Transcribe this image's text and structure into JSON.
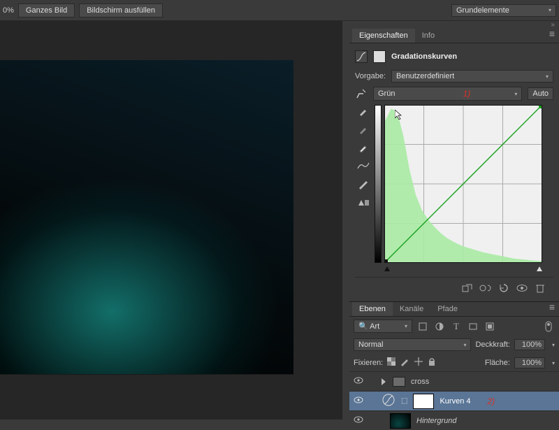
{
  "topbar": {
    "zoom": "0%",
    "fit_image": "Ganzes Bild",
    "fill_screen": "Bildschirm ausfüllen",
    "workspace": "Grundelemente"
  },
  "properties": {
    "tab_properties": "Eigenschaften",
    "tab_info": "Info",
    "title": "Gradationskurven",
    "preset_label": "Vorgabe:",
    "preset_value": "Benutzerdefiniert",
    "channel_value": "Grün",
    "auto_btn": "Auto",
    "annotation1": "1)"
  },
  "chart_data": {
    "type": "area",
    "title": "Grün channel histogram with curve",
    "xlabel": "",
    "ylabel": "",
    "xlim": [
      0,
      255
    ],
    "ylim": [
      0,
      255
    ],
    "series": [
      {
        "name": "curve",
        "type": "line",
        "x": [
          0,
          255
        ],
        "values": [
          0,
          255
        ]
      },
      {
        "name": "histogram",
        "type": "area",
        "x": [
          0,
          10,
          20,
          30,
          40,
          50,
          60,
          70,
          80,
          90,
          100,
          110,
          120,
          130,
          140,
          150,
          160,
          170,
          180,
          190,
          200,
          210,
          220,
          230,
          240,
          255
        ],
        "values": [
          230,
          250,
          245,
          205,
          150,
          110,
          85,
          70,
          58,
          48,
          40,
          34,
          29,
          25,
          22,
          19,
          16,
          14,
          12,
          10,
          8,
          6,
          5,
          4,
          3,
          2
        ]
      }
    ],
    "curve_color": "#1aa321",
    "histogram_color": "#a8eaa3"
  },
  "layers": {
    "tab_layers": "Ebenen",
    "tab_channels": "Kanäle",
    "tab_paths": "Pfade",
    "filter_label": "Art",
    "blend_mode": "Normal",
    "opacity_label": "Deckkraft:",
    "opacity_value": "100%",
    "lock_label": "Fixieren:",
    "fill_label": "Fläche:",
    "fill_value": "100%",
    "items": [
      {
        "type": "group",
        "name": "cross"
      },
      {
        "type": "adjustment",
        "name": "Kurven 4",
        "selected": true,
        "annotation": "2)"
      },
      {
        "type": "image",
        "name": "Hintergrund"
      }
    ]
  }
}
